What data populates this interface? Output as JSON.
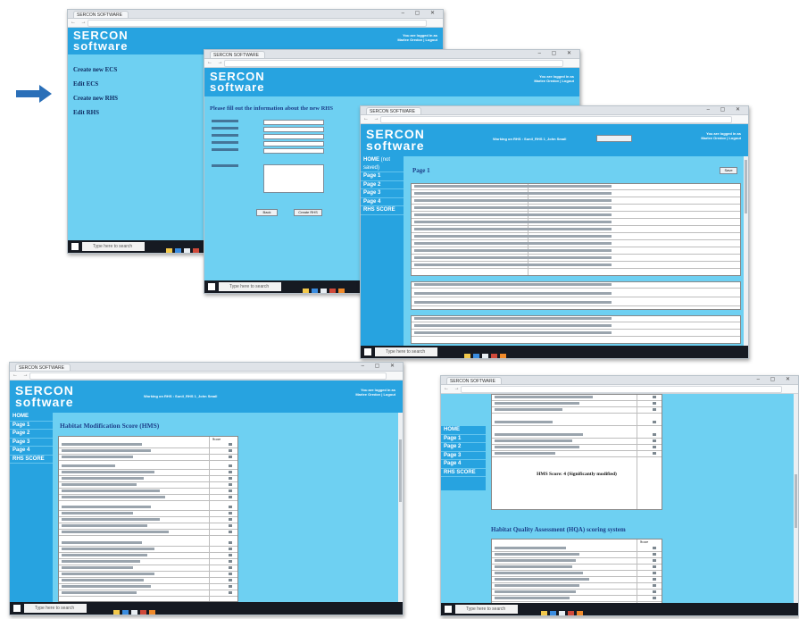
{
  "browser": {
    "tab_title": "SERCON SOFTWARE"
  },
  "logo": {
    "line1": "SERCON",
    "line2": "software"
  },
  "login": {
    "line1": "You are logged in as",
    "line2": "Marlee Oredov | Logout"
  },
  "home_menu": [
    "Create new ECS",
    "Edit ECS",
    "Create new RHS",
    "Edit RHS"
  ],
  "form": {
    "heading": "Please fill out the information about the new RHS",
    "buttons": [
      "Back",
      "Create RHS"
    ]
  },
  "working_on": "Working on RHS : Sunil_RHS 1_John Small",
  "side_nav": [
    "HOME",
    "Page 1",
    "Page 2",
    "Page 3",
    "Page 4",
    "RHS SCORE"
  ],
  "side_nav_extra": "(not saved)",
  "page1": {
    "title": "Page 1",
    "save_label": "Save"
  },
  "hms": {
    "title": "Habitat Modification Score (HMS)",
    "score_col": "Score"
  },
  "rhs_score": {
    "line": "HMS Score: 4 (Significantly modified)",
    "hqa_title": "Habitat Quality Assessment (HQA) scoring system",
    "score_col": "Score"
  },
  "taskbar": {
    "search_placeholder": "Type here to search"
  },
  "colors": {
    "banner": "#27a3e0",
    "page": "#6ed0f2",
    "arrow": "#2a6fb8"
  },
  "icons": [
    "arrow-right-icon",
    "windows-start-icon",
    "search-icon"
  ]
}
